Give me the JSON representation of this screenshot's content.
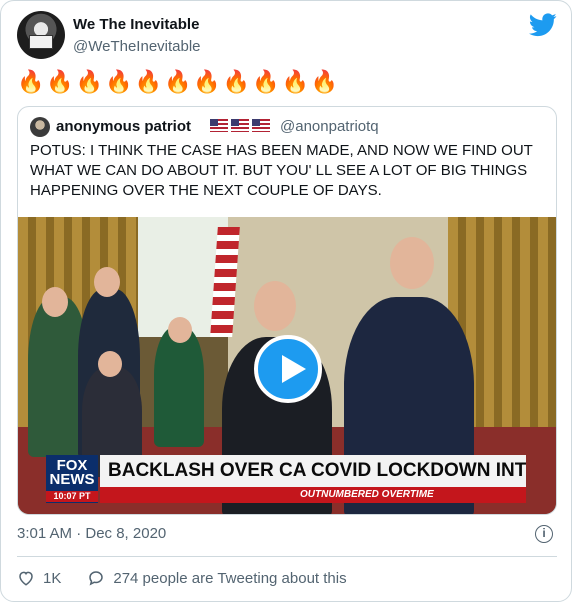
{
  "tweet": {
    "author_name": "We The Inevitable",
    "author_handle": "@WeTheInevitable",
    "body_emoji": "🔥🔥🔥🔥🔥🔥🔥🔥🔥🔥🔥",
    "icons": {
      "brand": "twitter-bird-icon",
      "avatar": "avatar"
    },
    "brand_color": "#1d9bf0"
  },
  "quoted": {
    "author_name": "anonymous patriot",
    "flags": "🇺🇸🇺🇸🇺🇸",
    "author_handle": "@anonpatriotq",
    "text": "POTUS: I THINK THE CASE HAS BEEN MADE, AND NOW WE FIND OUT WHAT WE CAN DO ABOUT IT. BUT YOU'  LL SEE A LOT OF BIG THINGS HAPPENING OVER THE NEXT COUPLE OF DAYS.",
    "video": {
      "network_logo": "FOX NEWS",
      "network_time": "10:07 PT",
      "headline": "BACKLASH OVER CA COVID LOCKDOWN INTENSIFIES",
      "show_name": "OUTNUMBERED OVERTIME",
      "play_icon": "play-icon"
    }
  },
  "meta": {
    "timestamp": "3:01 AM · Dec 8, 2020",
    "info_icon": "info-icon"
  },
  "actions": {
    "like_count": "1K",
    "conversation_text": "274 people are Tweeting about this",
    "icons": [
      "heart-icon",
      "reply-icon"
    ]
  }
}
